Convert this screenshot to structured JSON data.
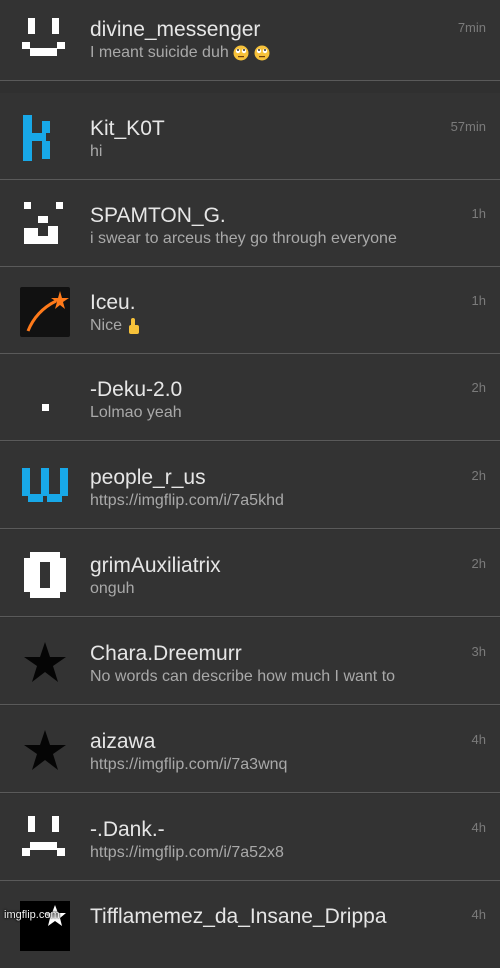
{
  "conversations": [
    {
      "name": "divine_messenger",
      "message": "I meant suicide duh",
      "time": "7min",
      "avatar": "pixel-face-avatar",
      "emoji": [
        "eye-roll-emoji",
        "eye-roll-emoji"
      ]
    },
    {
      "name": "Kit_K0T",
      "message": "hi",
      "time": "57min",
      "avatar": "blue-pixel-k-avatar"
    },
    {
      "name": "SPAMTON_G.",
      "message": "i swear to arceus they go through everyone",
      "time": "1h",
      "avatar": "pixel-smirk-avatar"
    },
    {
      "name": "Iceu.",
      "message": "Nice",
      "time": "1h",
      "avatar": "shooting-star-avatar",
      "emoji": [
        "thumbs-up-emoji"
      ]
    },
    {
      "name": "-Deku-2.0",
      "message": "Lolmao yeah",
      "time": "2h",
      "avatar": "dot-avatar"
    },
    {
      "name": "people_r_us",
      "message": "https://imgflip.com/i/7a5khd",
      "time": "2h",
      "avatar": "blue-pixel-w-avatar"
    },
    {
      "name": "grimAuxiliatrix",
      "message": "onguh",
      "time": "2h",
      "avatar": "pixel-zero-avatar"
    },
    {
      "name": "Chara.Dreemurr",
      "message": "No words can describe how much I want to",
      "time": "3h",
      "avatar": "black-star-avatar"
    },
    {
      "name": "aizawa",
      "message": "https://imgflip.com/i/7a3wnq",
      "time": "4h",
      "avatar": "black-star-avatar"
    },
    {
      "name": "-.Dank.-",
      "message": "https://imgflip.com/i/7a52x8",
      "time": "4h",
      "avatar": "pixel-sad-face-avatar"
    },
    {
      "name": "Tifflamemez_da_Insane_Drippa",
      "message": "",
      "time": "4h",
      "avatar": "black-star-avatar"
    }
  ],
  "watermark": "imgflip.com",
  "colors": {
    "background": "#333333",
    "name": "#e6e6e6",
    "message": "#a9a9a9",
    "time": "#7b7b7b",
    "divider": "#5a5a5a",
    "accent_blue": "#18a8e8"
  }
}
